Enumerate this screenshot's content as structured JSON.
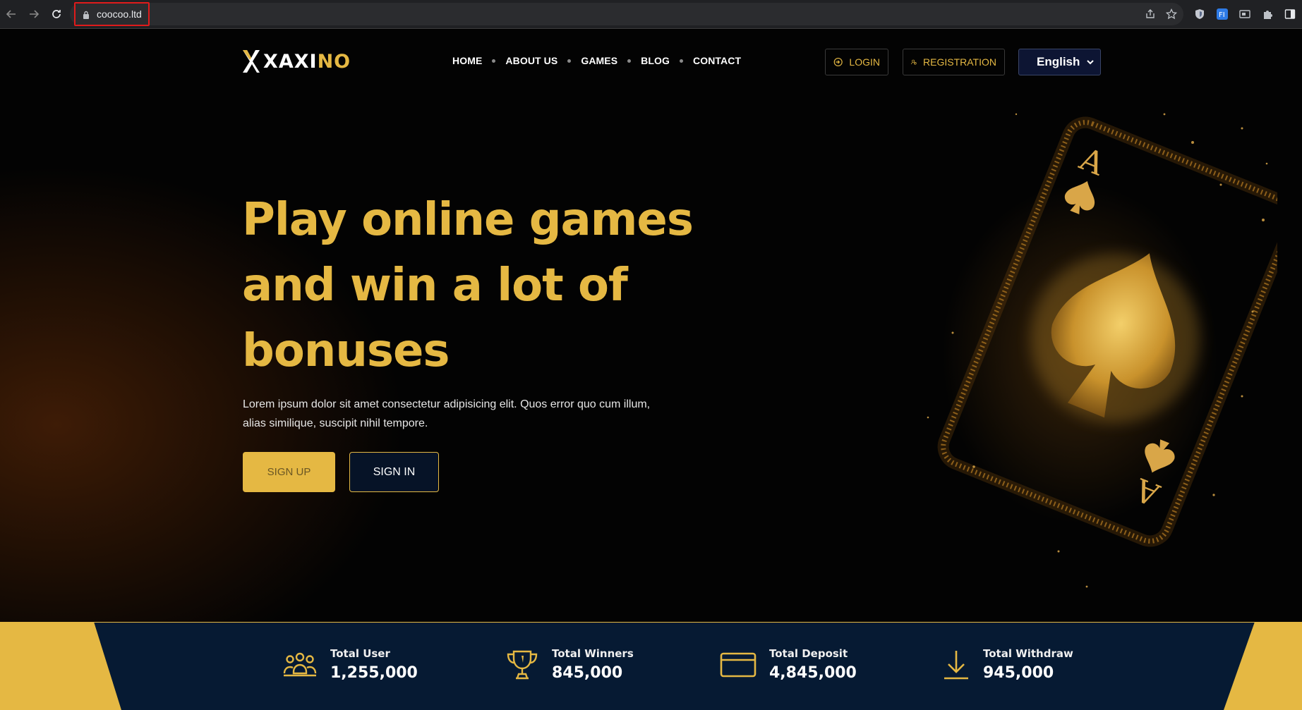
{
  "browser": {
    "url": "coocoo.ltd"
  },
  "brand": {
    "logo_text_white": "XAXI",
    "logo_text_gold": "NO",
    "gold": "#e5b843",
    "navy": "#061327"
  },
  "nav": {
    "items": [
      "HOME",
      "ABOUT US",
      "GAMES",
      "BLOG",
      "CONTACT"
    ]
  },
  "header": {
    "login_label": "LOGIN",
    "registration_label": "REGISTRATION",
    "language": "English"
  },
  "hero": {
    "title_line1": "Play online games",
    "title_line2": "and win a lot of",
    "title_line3": "bonuses",
    "description_line1": "Lorem ipsum dolor sit amet consectetur adipisicing elit. Quos error quo cum illum,",
    "description_line2": "alias similique, suscipit nihil tempore.",
    "signup_label": "SIGN UP",
    "signin_label": "SIGN IN"
  },
  "stats": [
    {
      "label": "Total User",
      "value": "1,255,000",
      "icon": "users-icon"
    },
    {
      "label": "Total Winners",
      "value": "845,000",
      "icon": "trophy-icon"
    },
    {
      "label": "Total Deposit",
      "value": "4,845,000",
      "icon": "card-icon"
    },
    {
      "label": "Total Withdraw",
      "value": "945,000",
      "icon": "download-icon"
    }
  ]
}
